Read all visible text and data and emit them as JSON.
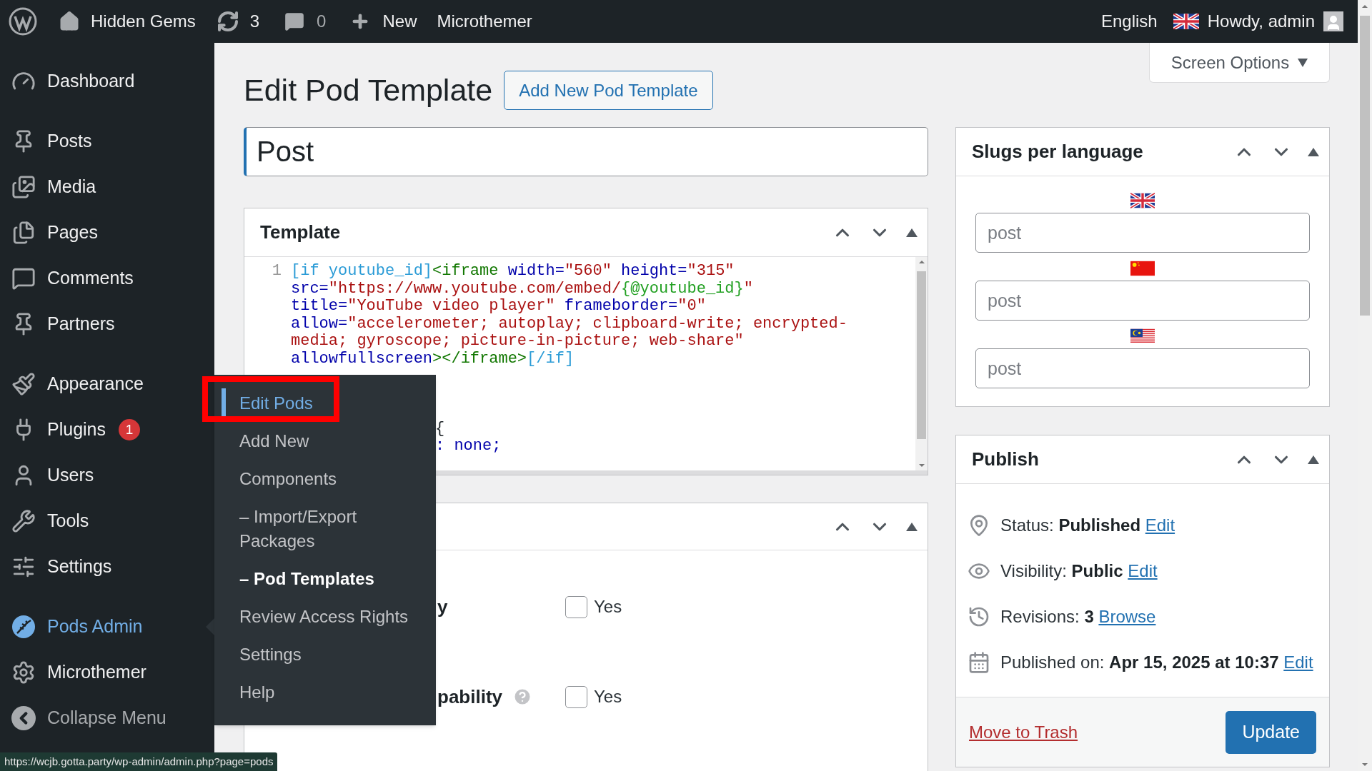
{
  "admin_bar": {
    "site_name": "Hidden Gems",
    "updates": "3",
    "comments": "0",
    "new_label": "New",
    "plugin_item": "Microthemer",
    "language": "English",
    "greeting": "Howdy, admin"
  },
  "sidebar": {
    "sections": [
      [
        {
          "label": "Dashboard",
          "selected": false
        }
      ],
      [
        {
          "label": "Posts",
          "selected": false
        },
        {
          "label": "Media",
          "selected": false
        },
        {
          "label": "Pages",
          "selected": false
        },
        {
          "label": "Comments",
          "selected": false
        },
        {
          "label": "Partners",
          "selected": false
        }
      ],
      [
        {
          "label": "Appearance",
          "selected": false
        },
        {
          "label": "Plugins",
          "selected": false,
          "badge": "1"
        },
        {
          "label": "Users",
          "selected": false
        },
        {
          "label": "Tools",
          "selected": false
        },
        {
          "label": "Settings",
          "selected": false
        }
      ],
      [
        {
          "label": "Pods Admin",
          "selected": true
        },
        {
          "label": "Microthemer",
          "selected": false
        }
      ]
    ],
    "collapse_label": "Collapse Menu"
  },
  "flyout": {
    "highlight_frame": true,
    "items": [
      {
        "label": "Edit Pods",
        "selected": true,
        "bold": false
      },
      {
        "label": "Add New",
        "selected": false,
        "bold": false
      },
      {
        "label": "Components",
        "selected": false,
        "bold": false
      },
      {
        "label": "– Import/Export Packages",
        "selected": false,
        "bold": false
      },
      {
        "label": "– Pod Templates",
        "selected": false,
        "bold": true
      },
      {
        "label": "Review Access Rights",
        "selected": false,
        "bold": false
      },
      {
        "label": "Settings",
        "selected": false,
        "bold": false
      },
      {
        "label": "Help",
        "selected": false,
        "bold": false
      }
    ]
  },
  "screen_options": "Screen Options",
  "page": {
    "heading": "Edit Pod Template",
    "add_new_button": "Add New Pod Template",
    "title_value": "Post"
  },
  "template_box": {
    "title": "Template",
    "line_number": "1",
    "code_tokens": [
      {
        "kind": "shortcode",
        "text": "[if youtube_id]"
      },
      {
        "kind": "tag",
        "text": "<iframe"
      },
      {
        "kind": "attr",
        "text": " width="
      },
      {
        "kind": "string",
        "text": "\"560\""
      },
      {
        "kind": "attr",
        "text": " height="
      },
      {
        "kind": "string",
        "text": "\"315\""
      },
      {
        "kind": "attr",
        "text": " src="
      },
      {
        "kind": "string",
        "text": "\"https://www.youtube.com/embed/"
      },
      {
        "kind": "var",
        "text": "{@youtube_id}"
      },
      {
        "kind": "string",
        "text": "\""
      },
      {
        "kind": "attr",
        "text": " title="
      },
      {
        "kind": "string",
        "text": "\"YouTube video player\""
      },
      {
        "kind": "attr",
        "text": " frameborder="
      },
      {
        "kind": "string",
        "text": "\"0\""
      },
      {
        "kind": "attr",
        "text": " allow="
      },
      {
        "kind": "string",
        "text": "\"accelerometer; autoplay; clipboard-write; encrypted-media; gyroscope; picture-in-picture; web-share\""
      },
      {
        "kind": "attr",
        "text": " allowfullscreen"
      },
      {
        "kind": "tag",
        "text": "></iframe>"
      },
      {
        "kind": "shortcode",
        "text": "[/if]"
      }
    ],
    "fragments": [
      {
        "kind": "plain",
        "text": "{"
      },
      {
        "kind": "value",
        "text": ": none;"
      }
    ]
  },
  "options_box": {
    "rows": [
      {
        "label": "y",
        "help": false,
        "checked": false,
        "option": "Yes"
      },
      {
        "label": "pability",
        "help": true,
        "checked": false,
        "option": "Yes"
      }
    ]
  },
  "slugs_box": {
    "title": "Slugs per language",
    "fields": [
      {
        "placeholder": "post"
      },
      {
        "placeholder": "post"
      },
      {
        "placeholder": "post"
      }
    ]
  },
  "publish_box": {
    "title": "Publish",
    "rows": [
      {
        "kind": "status",
        "text": "Status: **Published**",
        "link": "Edit"
      },
      {
        "kind": "visibility",
        "text": "Visibility: **Public**",
        "link": "Edit"
      },
      {
        "kind": "revisions",
        "text": "Revisions: **3**",
        "link": "Browse"
      },
      {
        "kind": "date",
        "text": "Published on: **Apr 15, 2025 at 10:37**",
        "link": "Edit"
      }
    ],
    "trash_link": "Move to Trash",
    "update_button": "Update"
  },
  "status_url": "https://wcjb.gotta.party/wp-admin/admin.php?page=pods"
}
